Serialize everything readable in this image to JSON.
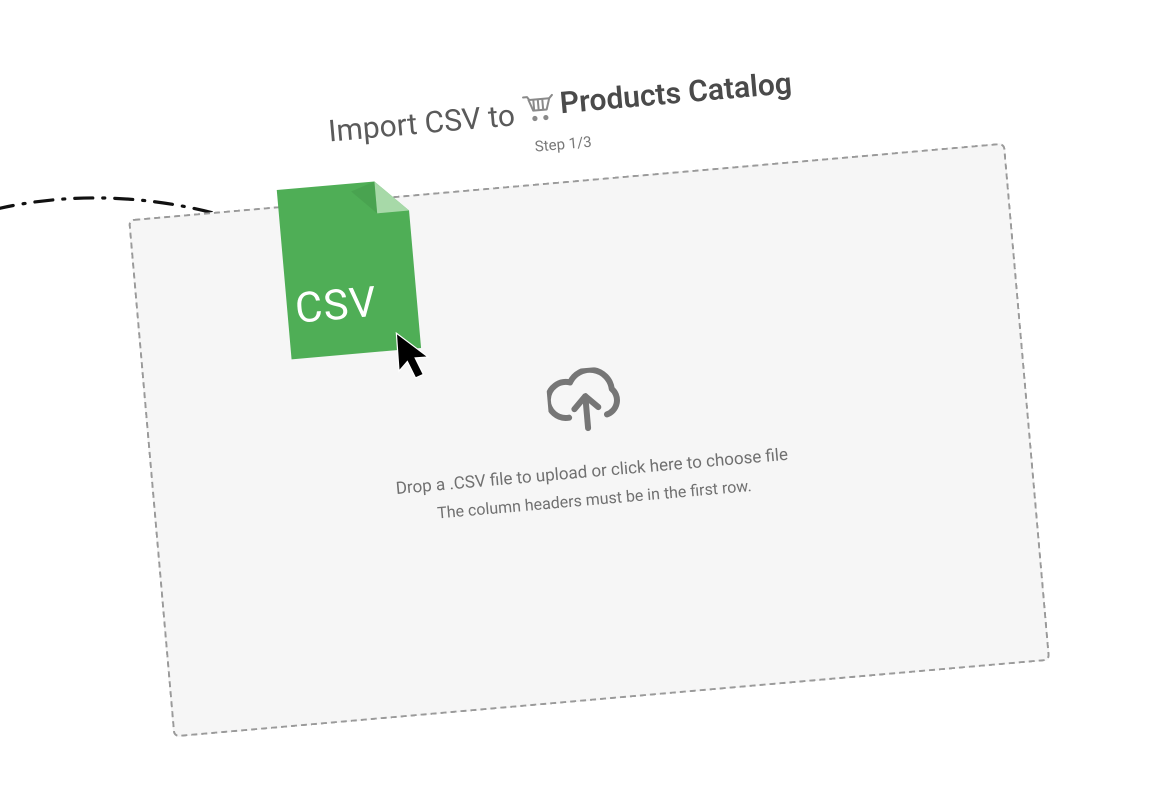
{
  "header": {
    "title_prefix": "Import CSV to",
    "title_strong": "Products Catalog",
    "step_label": "Step 1/3"
  },
  "dropzone": {
    "line1": "Drop a .CSV file to upload or click here to choose file",
    "line2": "The column headers must be in the first row."
  },
  "dragged_file": {
    "label": "CSV"
  },
  "icons": {
    "cart": "shopping-cart-icon",
    "upload": "cloud-upload-icon",
    "cursor": "cursor-icon",
    "file": "csv-file-icon"
  },
  "colors": {
    "file_green": "#4FAE56",
    "file_green_light": "#7CC57E",
    "file_green_dark": "#3E8E44",
    "border_gray": "#9a9a9a",
    "zone_bg": "#f6f6f6",
    "text_gray": "#6f6f6f"
  }
}
